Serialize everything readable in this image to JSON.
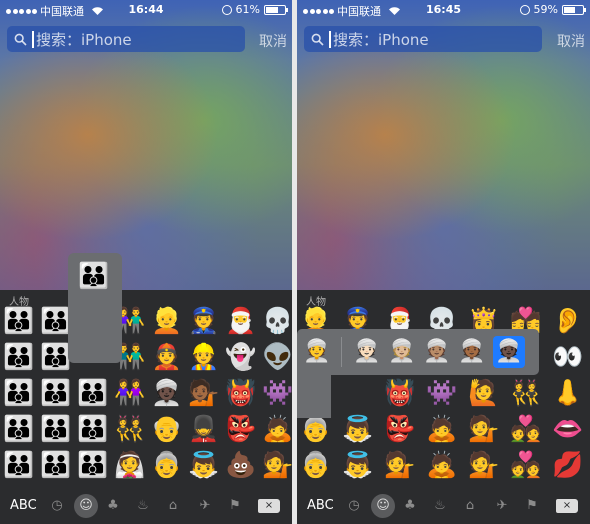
{
  "left": {
    "status": {
      "carrier": "中国联通",
      "time": "16:44",
      "battery": "61%",
      "battery_level": 0.61
    },
    "search": {
      "placeholder": "搜索：iPhone",
      "cancel_label": "取消"
    },
    "keyboard": {
      "section_label": "人物",
      "columns": [
        [
          "👪",
          "👪",
          "👪",
          "👪",
          "👪"
        ],
        [
          "👪",
          "👪",
          "👪",
          "👪",
          "👪"
        ],
        [
          "👪",
          "",
          "👪",
          "👪",
          "👪"
        ],
        [
          "👫",
          "👬",
          "👭",
          "👯",
          "👰"
        ],
        [
          "👱",
          "👲",
          "👳🏿",
          "👴",
          "👵"
        ],
        [
          "👮",
          "👷",
          "💁🏾",
          "💂",
          "👼"
        ],
        [
          "🎅",
          "👻",
          "👹",
          "👺",
          "💩"
        ],
        [
          "💀",
          "👽",
          "👾",
          "🙇",
          "💁"
        ]
      ],
      "popup_emoji": "👪",
      "toolbar": {
        "abc_label": "ABC",
        "icons": [
          "recent-icon",
          "smiley-icon",
          "nature-icon",
          "objects-icon",
          "places-icon",
          "travel-icon",
          "symbols-icon"
        ],
        "delete_label": "×"
      }
    }
  },
  "right": {
    "status": {
      "carrier": "中国联通",
      "time": "16:45",
      "battery": "59%",
      "battery_level": 0.59
    },
    "search": {
      "placeholder": "搜索：iPhone",
      "cancel_label": "取消"
    },
    "keyboard": {
      "section_label": "人物",
      "columns": [
        [
          "👱",
          "",
          "",
          "👵",
          "👵"
        ],
        [
          "👮",
          "",
          "",
          "👼",
          "👼"
        ],
        [
          "🎅",
          "👹",
          "👹",
          "👺",
          "💁"
        ],
        [
          "💀",
          "👾",
          "👾",
          "🙇",
          "🙇"
        ],
        [
          "👸",
          "🙋",
          "🙋",
          "💁",
          "💁"
        ],
        [
          "💏",
          "👯",
          "👯",
          "💑",
          "💑"
        ],
        [
          "👂",
          "👀",
          "👃",
          "👄",
          "💋"
        ]
      ],
      "variants": [
        "👳",
        "👳🏻",
        "👳🏼",
        "👳🏽",
        "👳🏾",
        "👳🏿"
      ],
      "toolbar": {
        "abc_label": "ABC",
        "icons": [
          "recent-icon",
          "smiley-icon",
          "nature-icon",
          "objects-icon",
          "places-icon",
          "travel-icon",
          "symbols-icon"
        ],
        "delete_label": "×"
      }
    }
  }
}
